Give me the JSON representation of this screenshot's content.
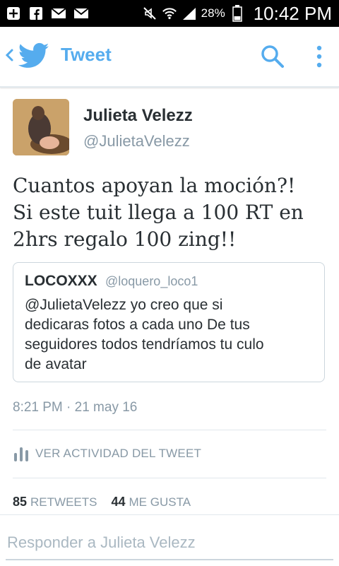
{
  "status_bar": {
    "battery_percent": "28%",
    "time": "10:42 PM",
    "icons": [
      "add-icon",
      "facebook-icon",
      "mail-icon",
      "mail-icon",
      "mute-icon",
      "wifi-icon",
      "signal-icon",
      "battery-icon"
    ]
  },
  "app_bar": {
    "title": "Tweet",
    "accent_color": "#55acee"
  },
  "tweet": {
    "author_name": "Julieta Velezz",
    "author_handle": "@JulietaVelezz",
    "text_lines": [
      "Cuantos apoyan la moción?!",
      "Si este tuit llega a 100 RT en",
      "2hrs regalo 100 zing!!"
    ],
    "timestamp": "8:21 PM · 21 may 16"
  },
  "quote": {
    "author_name": "LOCOXXX",
    "author_handle": "@loquero_loco1",
    "text_lines": [
      "@JulietaVelezz yo creo que si",
      "dedicaras fotos a cada uno De tus",
      "seguidores todos tendríamos tu culo",
      "de avatar"
    ]
  },
  "activity": {
    "label": "VER ACTIVIDAD DEL TWEET"
  },
  "stats": {
    "retweets_count": "85",
    "retweets_label": "RETWEETS",
    "likes_count": "44",
    "likes_label": "ME GUSTA"
  },
  "reply": {
    "placeholder": "Responder a Julieta Velezz"
  }
}
